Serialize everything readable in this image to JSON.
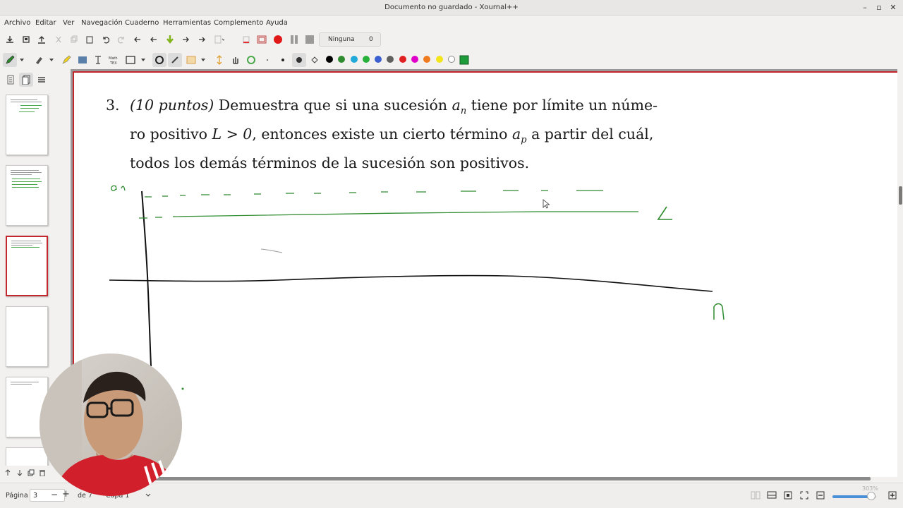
{
  "window": {
    "title": "Documento no guardado - Xournal++",
    "minimize": "–",
    "maximize": "▫",
    "close": "✕"
  },
  "menu": [
    "Archivo",
    "Editar",
    "Ver",
    "Navegación",
    "Cuaderno",
    "Herramientas",
    "Complemento",
    "Ayuda"
  ],
  "toolbar": {
    "layer_name": "Ninguna",
    "layer_count": "0"
  },
  "colors": {
    "accent_red": "#c4262e",
    "ink_green": "#2e8b2e",
    "palette": [
      "#000000",
      "#2e8b2e",
      "#27b03a",
      "#21a9d9",
      "#1f9c3a",
      "#3b5fd1",
      "#606060",
      "#e0201f",
      "#e000c8",
      "#f07a1e",
      "#f2e51a",
      "#ffffff",
      "#1f9c3a"
    ]
  },
  "document": {
    "problem_number": "3.",
    "line1_italic": "(10 puntos)",
    "line1_rest": " Demuestra que si una sucesión ",
    "line1_var": "a",
    "line1_sub": "n",
    "line1_end": " tiene por límite un núme-",
    "line2_start": "ro positivo ",
    "line2_math": "L > 0",
    "line2_mid": ", entonces existe un cierto término ",
    "line2_var": "a",
    "line2_sub": "p",
    "line2_end": " a partir del cuál,",
    "line3": "todos los demás términos de la sucesión son positivos."
  },
  "handwriting": {
    "y_axis_label": "an",
    "limit_label": "L",
    "x_axis_label": "n"
  },
  "statusbar": {
    "page_label": "Página",
    "page_value": "3",
    "page_of": "de 7",
    "layer_label": "Capa 1",
    "zoom_value": "303%",
    "zoom_fraction": 0.88
  }
}
